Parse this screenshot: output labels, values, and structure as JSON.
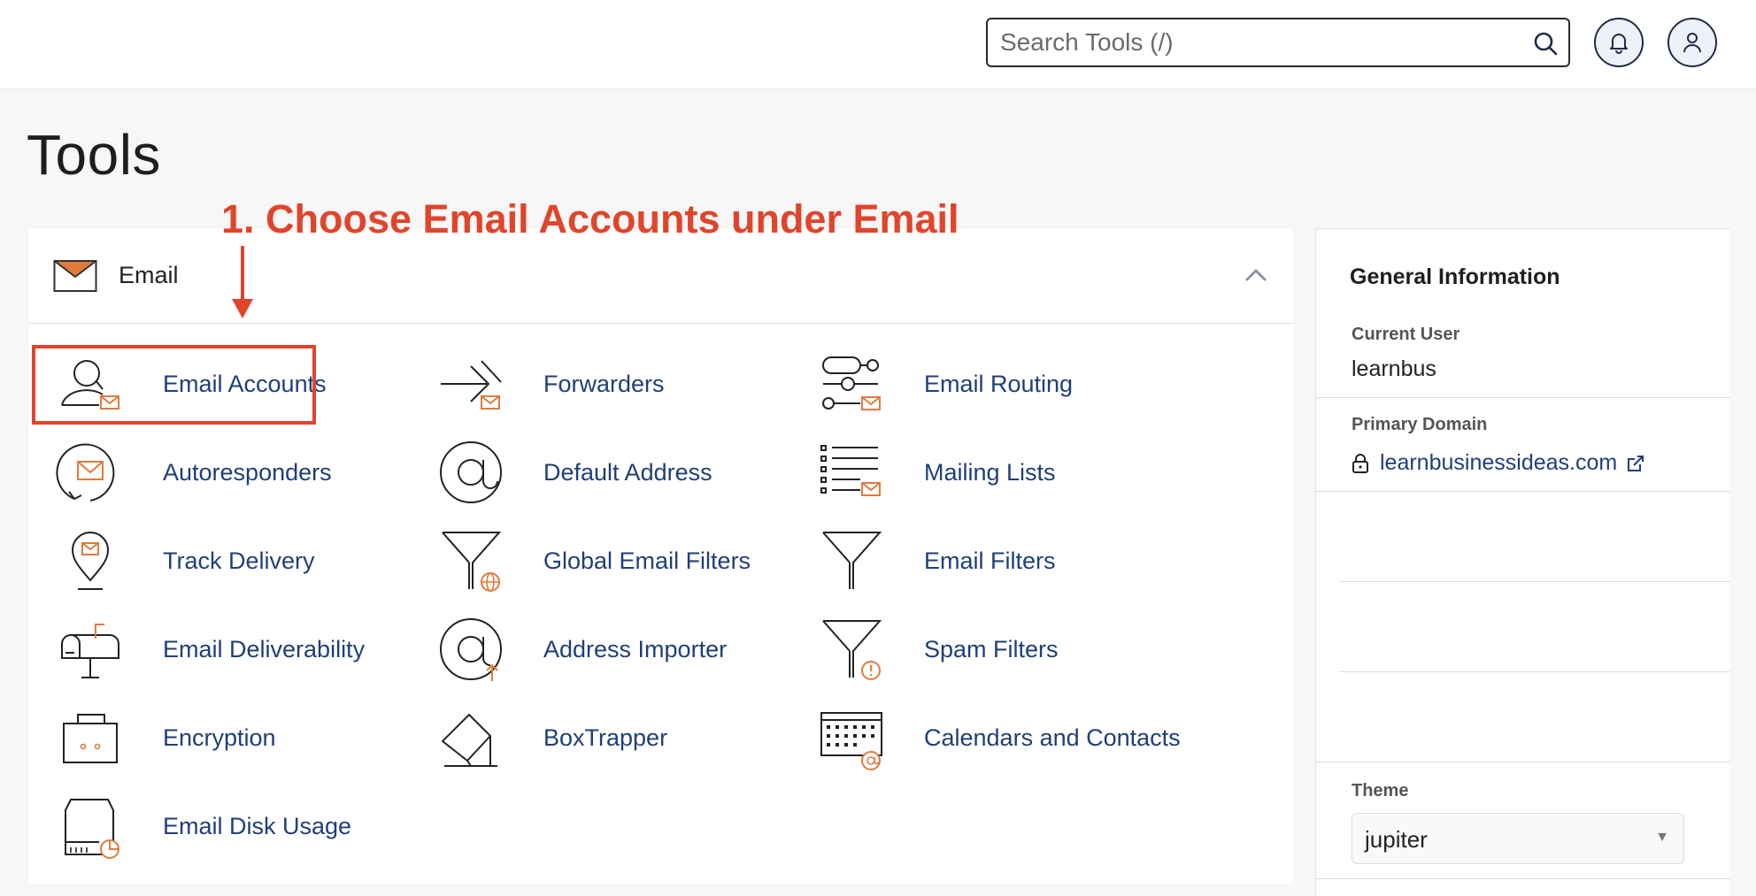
{
  "header": {
    "search_placeholder": "Search Tools (/)",
    "icons": {
      "search": "search-icon",
      "notifications": "bell-icon",
      "user": "user-icon"
    }
  },
  "page": {
    "title": "Tools"
  },
  "annotation": {
    "text": "1. Choose Email Accounts under Email",
    "color": "#e0452b"
  },
  "email_panel": {
    "title": "Email",
    "tools": [
      {
        "label": "Email Accounts",
        "icon": "email-accounts-icon"
      },
      {
        "label": "Forwarders",
        "icon": "forwarders-icon"
      },
      {
        "label": "Email Routing",
        "icon": "email-routing-icon"
      },
      {
        "label": "Autoresponders",
        "icon": "autoresponders-icon"
      },
      {
        "label": "Default Address",
        "icon": "default-address-icon"
      },
      {
        "label": "Mailing Lists",
        "icon": "mailing-lists-icon"
      },
      {
        "label": "Track Delivery",
        "icon": "track-delivery-icon"
      },
      {
        "label": "Global Email Filters",
        "icon": "global-email-filters-icon"
      },
      {
        "label": "Email Filters",
        "icon": "email-filters-icon"
      },
      {
        "label": "Email Deliverability",
        "icon": "email-deliverability-icon"
      },
      {
        "label": "Address Importer",
        "icon": "address-importer-icon"
      },
      {
        "label": "Spam Filters",
        "icon": "spam-filters-icon"
      },
      {
        "label": "Encryption",
        "icon": "encryption-icon"
      },
      {
        "label": "BoxTrapper",
        "icon": "boxtrapper-icon"
      },
      {
        "label": "Calendars and Contacts",
        "icon": "calendars-contacts-icon"
      },
      {
        "label": "Email Disk Usage",
        "icon": "email-disk-usage-icon"
      }
    ]
  },
  "sidebar": {
    "title": "General Information",
    "current_user_label": "Current User",
    "current_user": "learnbus",
    "primary_domain_label": "Primary Domain",
    "primary_domain": "learnbusinessideas.com",
    "theme_label": "Theme",
    "theme_value": "jupiter"
  },
  "colors": {
    "accent_orange": "#e07b3c",
    "link_blue": "#1f3f7a",
    "annotation_red": "#e0452b"
  }
}
